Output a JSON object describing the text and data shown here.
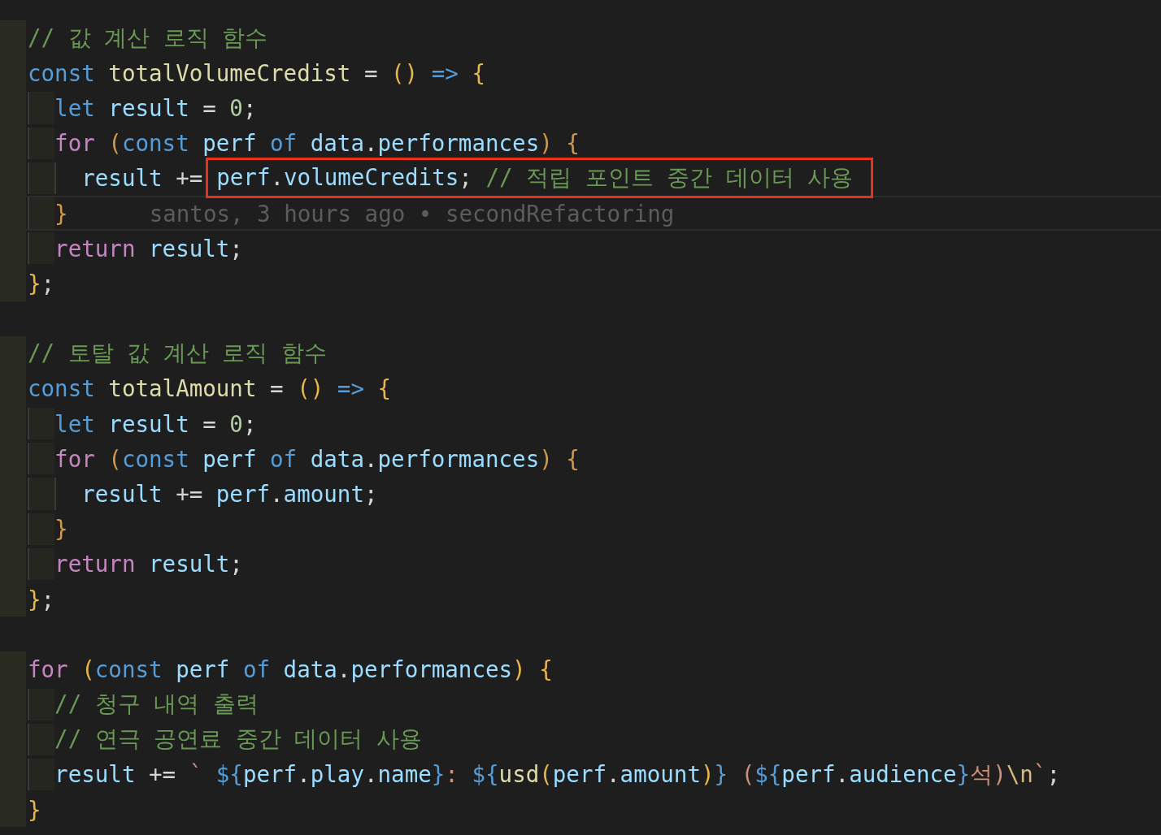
{
  "lines": [
    {
      "kind": "code",
      "tokens": [
        {
          "text": "// 값 계산 로직 함수",
          "kind": "comment"
        }
      ]
    },
    {
      "kind": "code",
      "tokens": [
        {
          "text": "const ",
          "kind": "keyword"
        },
        {
          "text": "totalVolumeCredist",
          "kind": "name"
        },
        {
          "text": " = ",
          "kind": "op"
        },
        {
          "text": "()",
          "kind": "bracket"
        },
        {
          "text": " => ",
          "kind": "keyword"
        },
        {
          "text": "{",
          "kind": "bracket"
        }
      ],
      "children": [
        {
          "kind": "code",
          "tokens": [
            {
              "text": "let ",
              "kind": "keyword"
            },
            {
              "text": "result",
              "kind": "var"
            },
            {
              "text": " = ",
              "kind": "op"
            },
            {
              "text": "0",
              "kind": "number"
            },
            {
              "text": ";",
              "kind": "op"
            }
          ]
        },
        {
          "kind": "code",
          "tokens": [
            {
              "text": "for ",
              "kind": "control"
            },
            {
              "text": "(",
              "kind": "bracket2"
            },
            {
              "text": "const ",
              "kind": "keyword"
            },
            {
              "text": "perf ",
              "kind": "var"
            },
            {
              "text": "of ",
              "kind": "keyword"
            },
            {
              "text": "data",
              "kind": "var"
            },
            {
              "text": ".",
              "kind": "op"
            },
            {
              "text": "performances",
              "kind": "var"
            },
            {
              "text": ") ",
              "kind": "bracket2"
            },
            {
              "text": "{",
              "kind": "bracket2"
            }
          ],
          "children": [
            {
              "kind": "code",
              "tokens": [
                {
                  "text": "result ",
                  "kind": "var"
                },
                {
                  "text": "+=",
                  "kind": "op"
                }
              ],
              "boxed": [
                {
                  "text": "perf",
                  "kind": "var"
                },
                {
                  "text": ".",
                  "kind": "op"
                },
                {
                  "text": "volumeCredits",
                  "kind": "var"
                },
                {
                  "text": "; ",
                  "kind": "op"
                },
                {
                  "text": "// 적립 포인트 중간 데이터 사용",
                  "kind": "comment"
                }
              ]
            }
          ]
        },
        {
          "kind": "code",
          "current": true,
          "tokens": [
            {
              "text": "}",
              "kind": "bracket2"
            }
          ],
          "blame": "santos, 3 hours ago • secondRefactoring"
        },
        {
          "kind": "code",
          "tokens": [
            {
              "text": "return ",
              "kind": "control"
            },
            {
              "text": "result",
              "kind": "var"
            },
            {
              "text": ";",
              "kind": "op"
            }
          ]
        }
      ]
    },
    {
      "kind": "code",
      "tokens": [
        {
          "text": "}",
          "kind": "bracket"
        },
        {
          "text": ";",
          "kind": "op"
        }
      ]
    },
    {
      "kind": "blank"
    },
    {
      "kind": "code",
      "tokens": [
        {
          "text": "// 토탈 값 계산 로직 함수",
          "kind": "comment"
        }
      ]
    },
    {
      "kind": "code",
      "tokens": [
        {
          "text": "const ",
          "kind": "keyword"
        },
        {
          "text": "totalAmount",
          "kind": "name"
        },
        {
          "text": " = ",
          "kind": "op"
        },
        {
          "text": "()",
          "kind": "bracket"
        },
        {
          "text": " => ",
          "kind": "keyword"
        },
        {
          "text": "{",
          "kind": "bracket"
        }
      ],
      "children": [
        {
          "kind": "code",
          "tokens": [
            {
              "text": "let ",
              "kind": "keyword"
            },
            {
              "text": "result",
              "kind": "var"
            },
            {
              "text": " = ",
              "kind": "op"
            },
            {
              "text": "0",
              "kind": "number"
            },
            {
              "text": ";",
              "kind": "op"
            }
          ]
        },
        {
          "kind": "code",
          "tokens": [
            {
              "text": "for ",
              "kind": "control"
            },
            {
              "text": "(",
              "kind": "bracket2"
            },
            {
              "text": "const ",
              "kind": "keyword"
            },
            {
              "text": "perf ",
              "kind": "var"
            },
            {
              "text": "of ",
              "kind": "keyword"
            },
            {
              "text": "data",
              "kind": "var"
            },
            {
              "text": ".",
              "kind": "op"
            },
            {
              "text": "performances",
              "kind": "var"
            },
            {
              "text": ") ",
              "kind": "bracket2"
            },
            {
              "text": "{",
              "kind": "bracket2"
            }
          ],
          "children": [
            {
              "kind": "code",
              "tokens": [
                {
                  "text": "result ",
                  "kind": "var"
                },
                {
                  "text": "+= ",
                  "kind": "op"
                },
                {
                  "text": "perf",
                  "kind": "var"
                },
                {
                  "text": ".",
                  "kind": "op"
                },
                {
                  "text": "amount",
                  "kind": "var"
                },
                {
                  "text": ";",
                  "kind": "op"
                }
              ]
            }
          ]
        },
        {
          "kind": "code",
          "tokens": [
            {
              "text": "}",
              "kind": "bracket2"
            }
          ]
        },
        {
          "kind": "code",
          "tokens": [
            {
              "text": "return ",
              "kind": "control"
            },
            {
              "text": "result",
              "kind": "var"
            },
            {
              "text": ";",
              "kind": "op"
            }
          ]
        }
      ]
    },
    {
      "kind": "code",
      "tokens": [
        {
          "text": "}",
          "kind": "bracket"
        },
        {
          "text": ";",
          "kind": "op"
        }
      ]
    },
    {
      "kind": "blank"
    },
    {
      "kind": "code",
      "tokens": [
        {
          "text": "for ",
          "kind": "control"
        },
        {
          "text": "(",
          "kind": "bracket"
        },
        {
          "text": "const ",
          "kind": "keyword"
        },
        {
          "text": "perf ",
          "kind": "var"
        },
        {
          "text": "of ",
          "kind": "keyword"
        },
        {
          "text": "data",
          "kind": "var"
        },
        {
          "text": ".",
          "kind": "op"
        },
        {
          "text": "performances",
          "kind": "var"
        },
        {
          "text": ") ",
          "kind": "bracket"
        },
        {
          "text": "{",
          "kind": "bracket"
        }
      ],
      "children": [
        {
          "kind": "code",
          "tokens": [
            {
              "text": "// 청구 내역 출력",
              "kind": "comment"
            }
          ]
        },
        {
          "kind": "code",
          "tokens": [
            {
              "text": "// 연극 공연료 중간 데이터 사용",
              "kind": "comment"
            }
          ]
        },
        {
          "kind": "code",
          "tokens": [
            {
              "text": "result ",
              "kind": "var"
            },
            {
              "text": "+= ",
              "kind": "op"
            },
            {
              "text": "` ",
              "kind": "string"
            },
            {
              "text": "${",
              "kind": "keyword"
            },
            {
              "text": "perf",
              "kind": "var"
            },
            {
              "text": ".",
              "kind": "op"
            },
            {
              "text": "play",
              "kind": "var"
            },
            {
              "text": ".",
              "kind": "op"
            },
            {
              "text": "name",
              "kind": "var"
            },
            {
              "text": "}",
              "kind": "keyword"
            },
            {
              "text": ": ",
              "kind": "string"
            },
            {
              "text": "${",
              "kind": "keyword"
            },
            {
              "text": "usd",
              "kind": "func"
            },
            {
              "text": "(",
              "kind": "bracket"
            },
            {
              "text": "perf",
              "kind": "var"
            },
            {
              "text": ".",
              "kind": "op"
            },
            {
              "text": "amount",
              "kind": "var"
            },
            {
              "text": ")",
              "kind": "bracket"
            },
            {
              "text": "}",
              "kind": "keyword"
            },
            {
              "text": " (",
              "kind": "string"
            },
            {
              "text": "${",
              "kind": "keyword"
            },
            {
              "text": "perf",
              "kind": "var"
            },
            {
              "text": ".",
              "kind": "op"
            },
            {
              "text": "audience",
              "kind": "var"
            },
            {
              "text": "}",
              "kind": "keyword"
            },
            {
              "text": "석)",
              "kind": "string"
            },
            {
              "text": "\\n",
              "kind": "escape"
            },
            {
              "text": "`",
              "kind": "string"
            },
            {
              "text": ";",
              "kind": "op"
            }
          ]
        }
      ]
    },
    {
      "kind": "code",
      "tokens": [
        {
          "text": "}",
          "kind": "bracket"
        }
      ]
    }
  ]
}
